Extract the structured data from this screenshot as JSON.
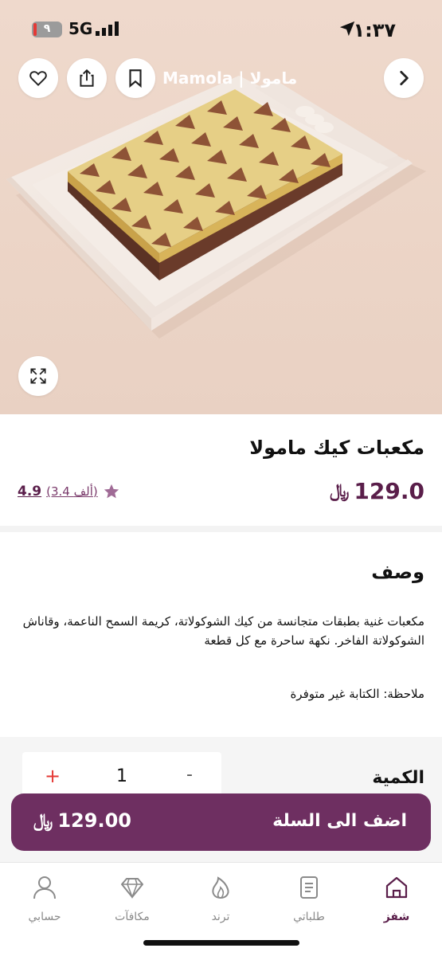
{
  "status_bar": {
    "time": "١:٣٧",
    "battery": "٩",
    "network": "5G"
  },
  "header": {
    "brand": "Mamola | مامولا"
  },
  "hero": {
    "image": "product-photo-cake-cubes"
  },
  "product": {
    "title": "مكعبات كيك مامولا",
    "price": "129.0",
    "currency_symbol": "﷼",
    "rating_value": "4.9",
    "rating_count": "(3.4 ألف)"
  },
  "description": {
    "heading": "وصف",
    "text": "مكعبات غنية بطبقات متجانسة من كيك الشوكولاتة، كريمة السمح الناعمة، وقاناش الشوكولاتة الفاخر. نكهة ساحرة مع كل قطعة",
    "note": "ملاحظة: الكتابة غير متوفرة"
  },
  "quantity": {
    "label": "الكمية",
    "value": "1",
    "plus": "+",
    "minus": "-"
  },
  "cart": {
    "label": "اضف الى السلة",
    "price": "129.00"
  },
  "tabs": [
    {
      "label": "شفز",
      "icon": "home-icon",
      "active": true
    },
    {
      "label": "طلباتي",
      "icon": "orders-icon",
      "active": false
    },
    {
      "label": "ترند",
      "icon": "trend-icon",
      "active": false
    },
    {
      "label": "مكافآت",
      "icon": "diamond-icon",
      "active": false
    },
    {
      "label": "حسابي",
      "icon": "account-icon",
      "active": false
    }
  ],
  "colors": {
    "accent": "#6e2f61",
    "price": "#5a1e4a",
    "hero_bg": "#ecd5c7",
    "plus": "#e53935"
  }
}
